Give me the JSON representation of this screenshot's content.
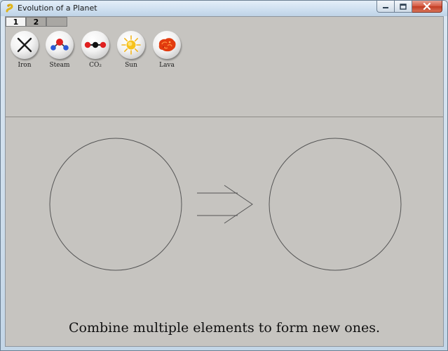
{
  "window": {
    "title": "Evolution of a Planet",
    "icon": "pygame-snake-icon"
  },
  "title_controls": [
    "minimize",
    "maximize",
    "close"
  ],
  "tabs": [
    {
      "label": "1",
      "selected": true
    },
    {
      "label": "2",
      "selected": false
    },
    {
      "label": "",
      "selected": false
    }
  ],
  "elements": [
    {
      "label": "Iron",
      "icon": "x-mark-icon"
    },
    {
      "label": "Steam",
      "icon": "steam-molecule-icon"
    },
    {
      "label": "CO₂",
      "icon": "co2-molecule-icon"
    },
    {
      "label": "Sun",
      "icon": "sun-icon"
    },
    {
      "label": "Lava",
      "icon": "lava-blob-icon"
    }
  ],
  "workspace": {
    "left_slot": "empty",
    "right_slot": "empty",
    "arrow": "arrow-right-icon"
  },
  "instructions": "Combine multiple elements to form new ones.",
  "colors": {
    "background": "#c6c4c0",
    "molecule_red": "#e02020",
    "molecule_blue": "#2b59d6",
    "sun_yellow": "#f7c21b",
    "lava_red": "#e23b0e"
  }
}
